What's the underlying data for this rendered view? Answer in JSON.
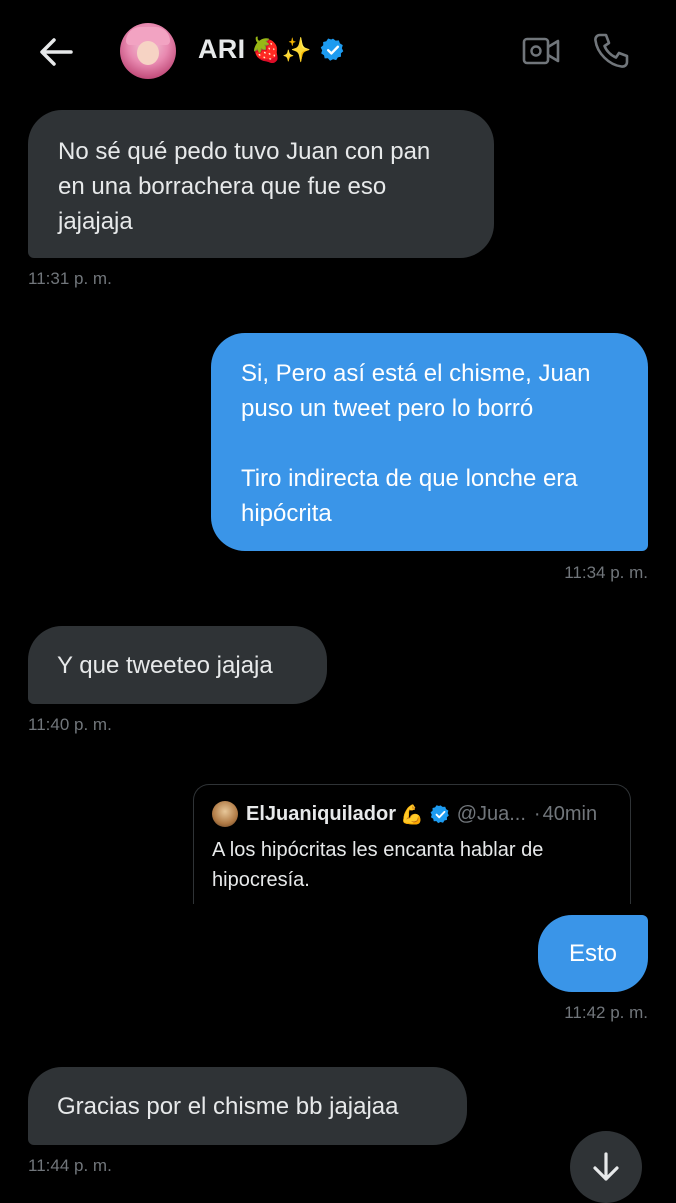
{
  "header": {
    "contact_name": "ARI",
    "name_emojis": "🍓✨",
    "icons": {
      "back": "back-arrow-icon",
      "video": "video-call-icon",
      "call": "phone-call-icon",
      "verified": "verified-badge-icon"
    }
  },
  "messages": [
    {
      "direction": "in",
      "text": "No sé qué pedo tuvo Juan con pan\nen una borrachera que fue eso\njajajaja",
      "time": "11:31 p. m."
    },
    {
      "direction": "out",
      "text": "Si, Pero así está el chisme, Juan\npuso un tweet pero lo borró\n\nTiro indirecta de que lonche era\nhipócrita",
      "time": "11:34 p. m."
    },
    {
      "direction": "in",
      "text": "Y que tweeteo jajaja",
      "time": "11:40 p. m."
    },
    {
      "direction": "out",
      "text": "Esto",
      "time": "11:42 p. m."
    },
    {
      "direction": "in",
      "text": "Gracias por el chisme bb jajajaa",
      "time": "11:44 p. m."
    }
  ],
  "quoted_tweet": {
    "author_name": "ElJuaniquilador",
    "author_emoji": "💪",
    "handle": "@Jua...",
    "separator": "·",
    "age": "40min",
    "text": "A los hipócritas les encanta hablar de\nhipocresía."
  },
  "scroll_button": {
    "icon": "arrow-down-icon"
  },
  "colors": {
    "background": "#000000",
    "incoming_bubble": "#2f3336",
    "outgoing_bubble": "#3a95e8",
    "timestamp": "#71767b",
    "verified": "#1d9bf0"
  }
}
